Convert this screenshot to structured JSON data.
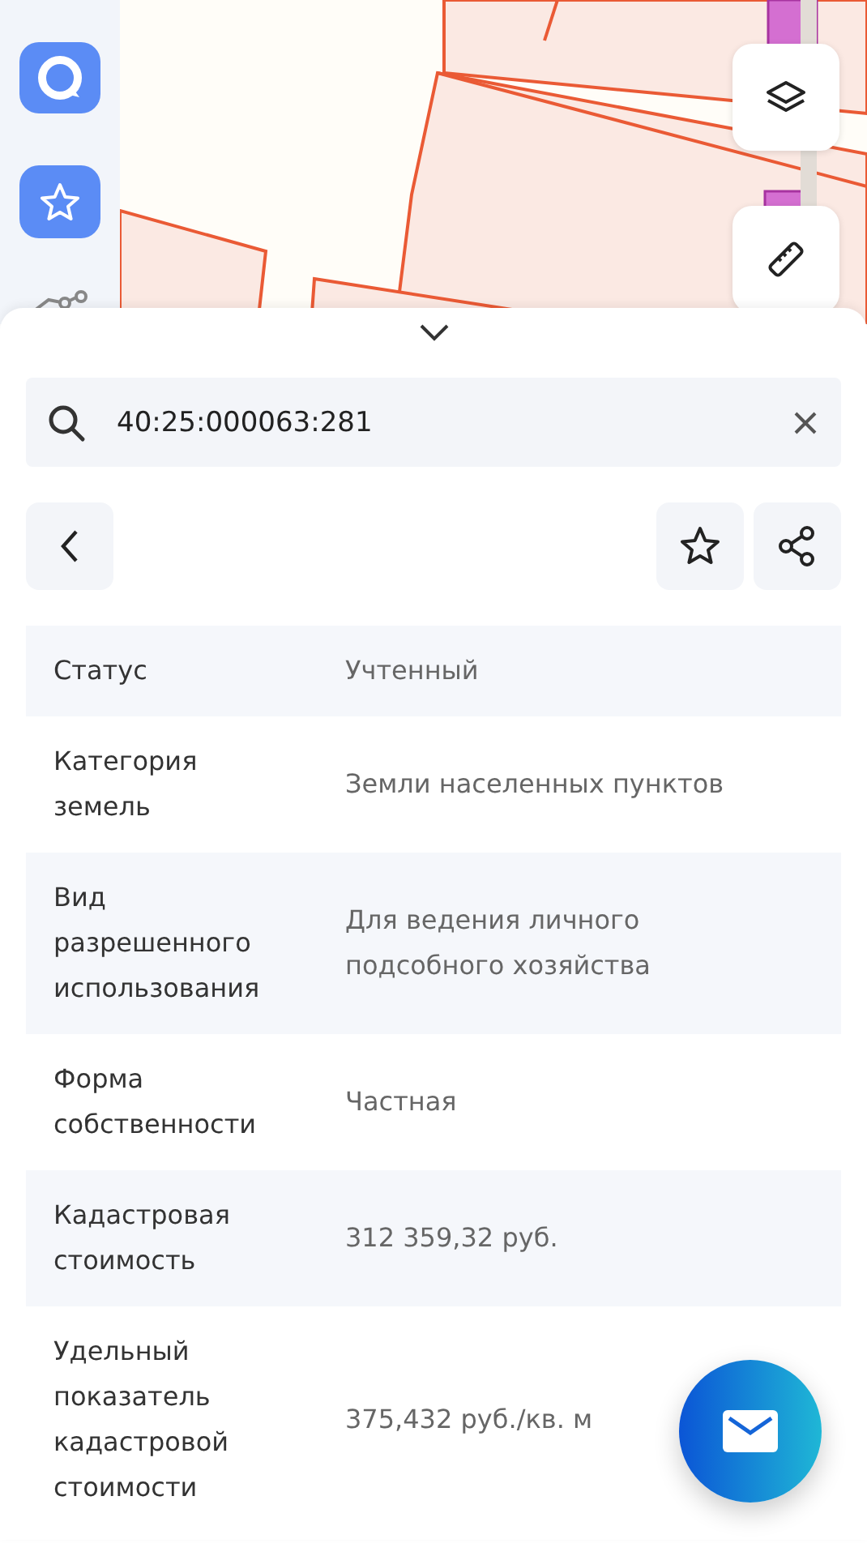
{
  "sidebar": {
    "items": [
      {
        "kind": "logo"
      },
      {
        "kind": "favorites"
      },
      {
        "kind": "route"
      }
    ]
  },
  "map": {
    "kind": "picture",
    "tools": [
      {
        "kind": "layers"
      },
      {
        "kind": "ruler"
      }
    ]
  },
  "search": {
    "value": "40:25:000063:281"
  },
  "actions": [
    {
      "kind": "back"
    },
    {
      "kind": "favorite"
    },
    {
      "kind": "share"
    }
  ],
  "details": [
    {
      "label": "Статус",
      "value": "Учтенный"
    },
    {
      "label": "Категория\nземель",
      "value": "Земли населенных пунктов"
    },
    {
      "label": "Вид\nразрешенного\nиспользования",
      "value": "Для ведения личного\nподсобного хозяйства"
    },
    {
      "label": "Форма\nсобственности",
      "value": "Частная"
    },
    {
      "label": "Кадастровая\nстоимость",
      "value": "312 359,32 руб."
    },
    {
      "label": "Удельный\nпоказатель\nкадастровой\nстоимости",
      "value": "375,432 руб./кв. м"
    }
  ],
  "fab": {
    "kind": "message"
  }
}
